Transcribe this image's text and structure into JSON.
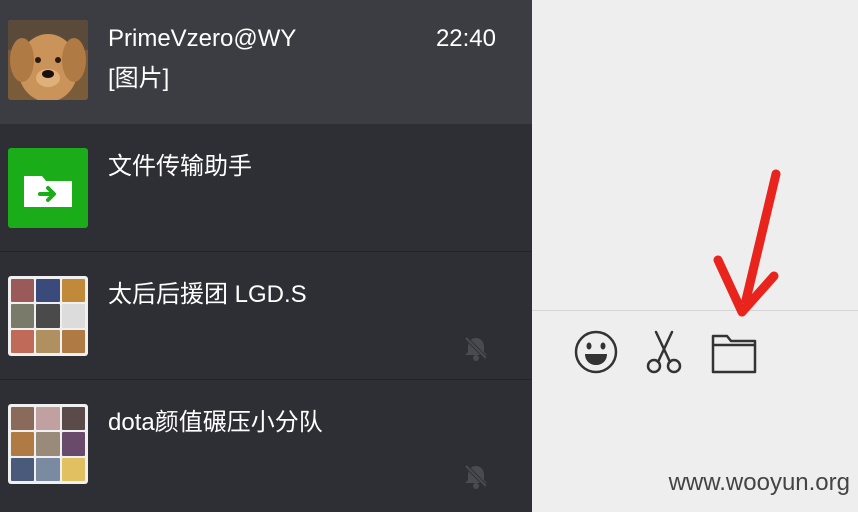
{
  "conversations": [
    {
      "name": "PrimeVzero@WY",
      "preview": "[图片]",
      "time": "22:40",
      "muted": false
    },
    {
      "name": "文件传输助手",
      "preview": "",
      "time": "",
      "muted": false
    },
    {
      "name": "太后后援团 LGD.S",
      "preview": "",
      "time": "",
      "muted": true
    },
    {
      "name": "dota颜值碾压小分队",
      "preview": "",
      "time": "",
      "muted": true
    }
  ],
  "toolbar": {
    "icons": [
      "emoji-icon",
      "scissors-icon",
      "folder-icon"
    ]
  },
  "watermark": "www.wooyun.org",
  "colors": {
    "sidebar_bg": "#2e2f34",
    "active_bg": "#3b3d42",
    "file_transfer_green": "#1aad19",
    "arrow_red": "#e8241c"
  }
}
